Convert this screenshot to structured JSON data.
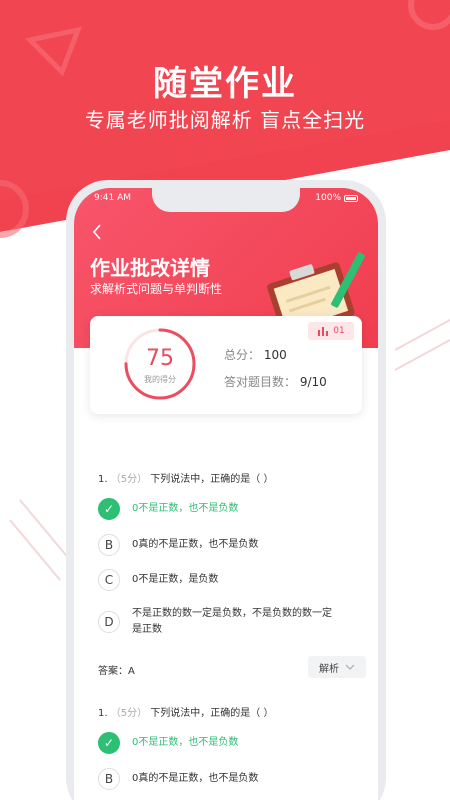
{
  "promo": {
    "title": "随堂作业",
    "subtitle": "专属老师批阅解析 盲点全扫光"
  },
  "status": {
    "time": "9:41 AM",
    "battery": "100%"
  },
  "header": {
    "title": "作业批改详情",
    "subtitle": "求解析式问题与单判断性"
  },
  "score_card": {
    "score": "75",
    "score_label": "我的得分",
    "total_key": "总分：",
    "total_val": "100",
    "correct_key": "答对题目数：",
    "correct_val": "9/10",
    "badge": "01",
    "progress": 0.75
  },
  "questions": [
    {
      "number": "1.",
      "points": "（5分）",
      "text": "下列说法中，正确的是（    ）",
      "options": [
        {
          "letter": "✓",
          "text": "0不是正数，也不是负数",
          "correct": true
        },
        {
          "letter": "B",
          "text": "0真的不是正数，也不是负数",
          "correct": false
        },
        {
          "letter": "C",
          "text": "0不是正数，是负数",
          "correct": false
        },
        {
          "letter": "D",
          "text": "不是正数的数一定是负数，不是负数的数一定是正数",
          "correct": false
        }
      ],
      "answer": "答案：A",
      "explain": "解析"
    },
    {
      "number": "1.",
      "points": "（5分）",
      "text": "下列说法中，正确的是（    ）",
      "options": [
        {
          "letter": "✓",
          "text": "0不是正数，也不是负数",
          "correct": true
        },
        {
          "letter": "B",
          "text": "0真的不是正数，也不是负数",
          "correct": false
        }
      ]
    }
  ],
  "colors": {
    "brand": "#f03e4f",
    "correct": "#2dbf73"
  }
}
